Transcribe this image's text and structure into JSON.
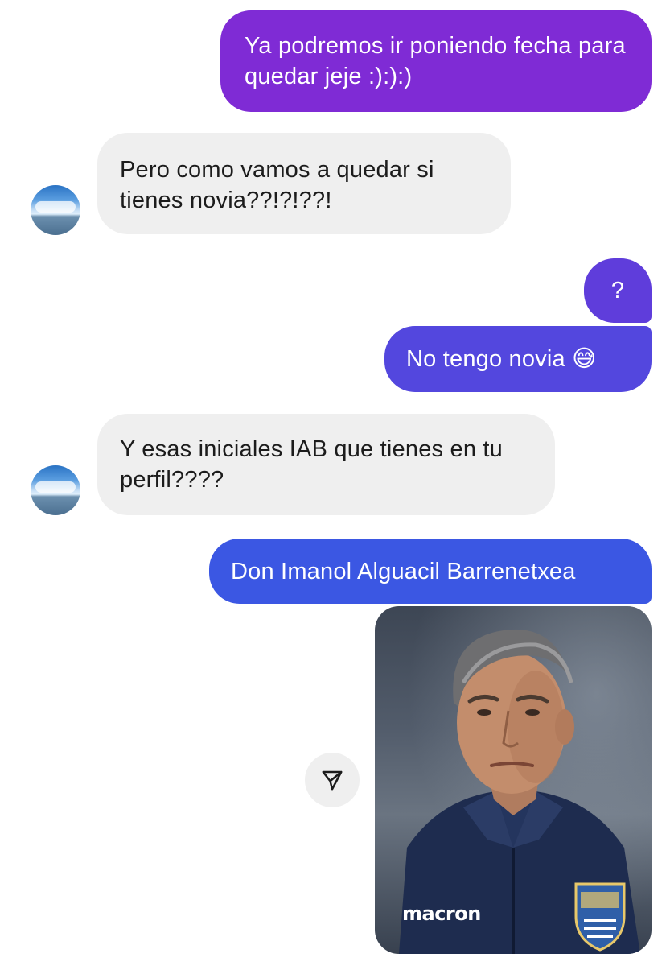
{
  "messages": [
    {
      "direction": "outgoing",
      "text": "Ya podremos ir poniendo fecha para quedar jeje :):):)"
    },
    {
      "direction": "incoming",
      "text": "Pero como vamos a quedar si tienes novia??!?!??!"
    },
    {
      "direction": "outgoing",
      "text": "?"
    },
    {
      "direction": "outgoing",
      "text": "No tengo novia 😅"
    },
    {
      "direction": "incoming",
      "text": "Y esas iniciales IAB que tienes en tu perfil????"
    },
    {
      "direction": "outgoing",
      "text": "Don Imanol Alguacil Barrenetxea"
    }
  ],
  "photo": {
    "logo_text": "macron"
  },
  "icons": {
    "share": "send-arrow-icon",
    "avatar": "sky-avatar"
  },
  "colors": {
    "outgoing_top": "#7e2bd6",
    "outgoing_bottom": "#3d55e0",
    "incoming_bg": "#efefef",
    "incoming_text": "#1c1c1c"
  }
}
